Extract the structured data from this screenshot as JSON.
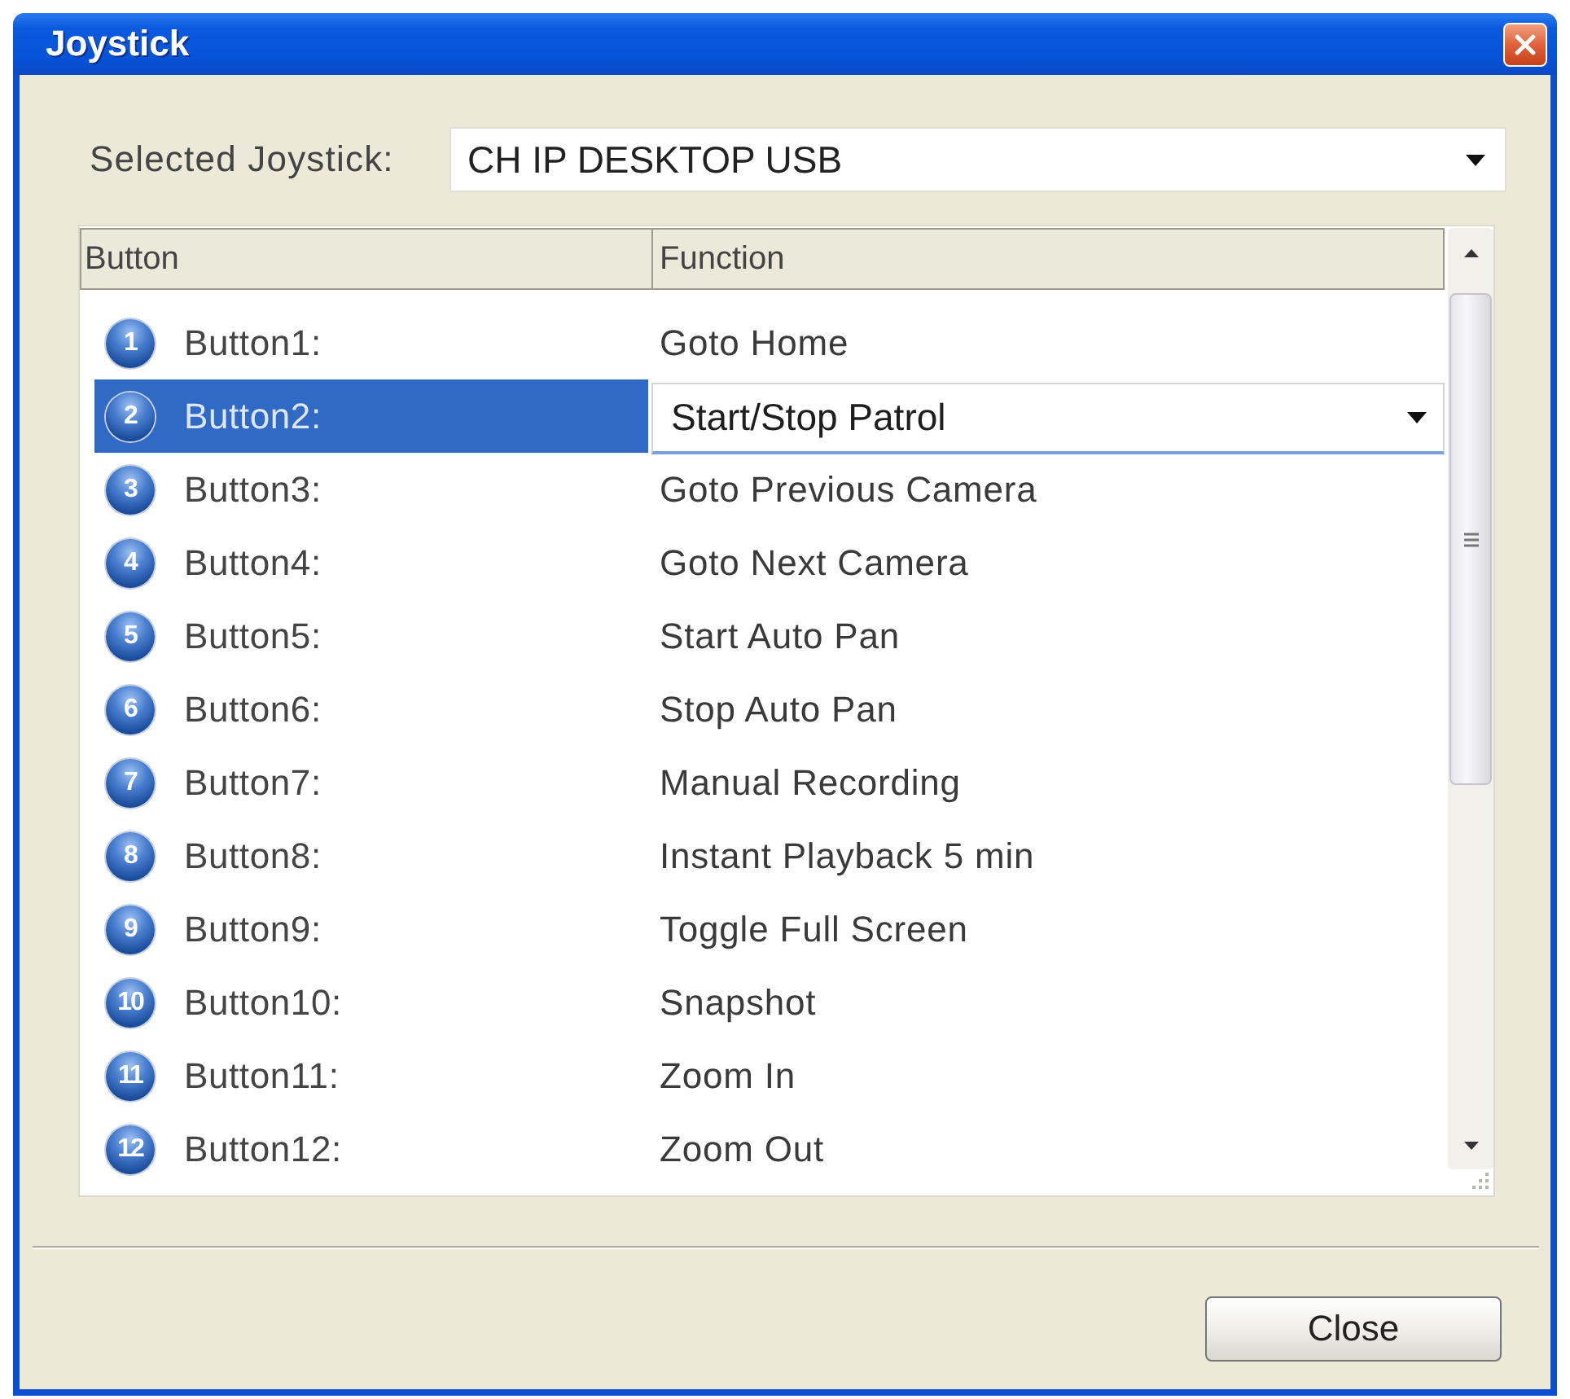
{
  "window": {
    "title": "Joystick"
  },
  "joystick": {
    "label": "Selected Joystick:",
    "value": "CH IP DESKTOP USB"
  },
  "table": {
    "columns": [
      "Button",
      "Function"
    ],
    "rows": [
      {
        "number": "1",
        "button": "Button1:",
        "function": "Goto Home",
        "selected": false
      },
      {
        "number": "2",
        "button": "Button2:",
        "function": "Start/Stop Patrol",
        "selected": true
      },
      {
        "number": "3",
        "button": "Button3:",
        "function": "Goto Previous Camera",
        "selected": false
      },
      {
        "number": "4",
        "button": "Button4:",
        "function": "Goto Next Camera",
        "selected": false
      },
      {
        "number": "5",
        "button": "Button5:",
        "function": "Start Auto Pan",
        "selected": false
      },
      {
        "number": "6",
        "button": "Button6:",
        "function": "Stop Auto Pan",
        "selected": false
      },
      {
        "number": "7",
        "button": "Button7:",
        "function": "Manual Recording",
        "selected": false
      },
      {
        "number": "8",
        "button": "Button8:",
        "function": "Instant Playback 5 min",
        "selected": false
      },
      {
        "number": "9",
        "button": "Button9:",
        "function": "Toggle Full Screen",
        "selected": false
      },
      {
        "number": "10",
        "button": "Button10:",
        "function": "Snapshot",
        "selected": false
      },
      {
        "number": "11",
        "button": "Button11:",
        "function": "Zoom In",
        "selected": false
      },
      {
        "number": "12",
        "button": "Button12:",
        "function": "Zoom Out",
        "selected": false
      }
    ]
  },
  "buttons": [
    "Close"
  ]
}
